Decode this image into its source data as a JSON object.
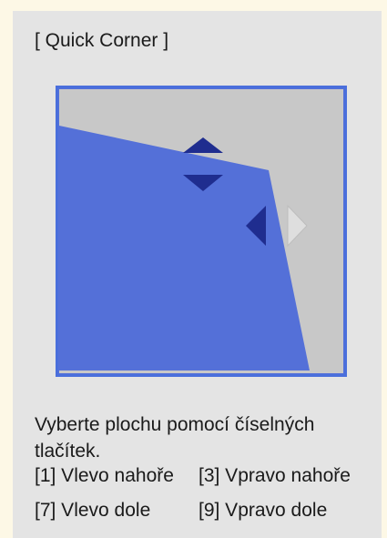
{
  "dialog": {
    "title": "[ Quick Corner ]",
    "instructions_line1": "Vyberte plochu pomocí číselných",
    "instructions_line2": "tlačítek.",
    "options": [
      {
        "label": "[1] Vlevo nahoře"
      },
      {
        "label": "[3] Vpravo nahoře"
      },
      {
        "label": "[7] Vlevo dole"
      },
      {
        "label": "[9] Vpravo dole"
      }
    ]
  },
  "colors": {
    "page_background": "#fdf8e6",
    "panel_background": "#e4e4e4",
    "preview_border": "#4a6fdc",
    "preview_fill": "#5470d8",
    "preview_bg": "#c8c8c8",
    "arrow_active": "#1f2d8f",
    "arrow_inactive": "#e0e0e0"
  },
  "icons": {
    "up": "arrow-up-icon",
    "down": "arrow-down-icon",
    "left": "arrow-left-icon",
    "right": "arrow-right-icon"
  }
}
